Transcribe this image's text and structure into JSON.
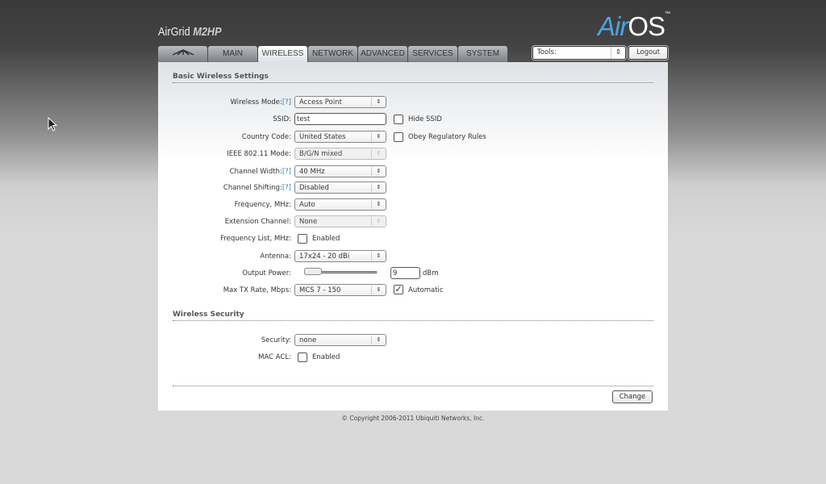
{
  "header": {
    "brand_prefix": "AirGrid",
    "brand_model": "M2HP",
    "logo_air": "Air",
    "logo_os": "OS",
    "logo_tm": "™"
  },
  "tabs": [
    {
      "label": ""
    },
    {
      "label": "MAIN"
    },
    {
      "label": "WIRELESS"
    },
    {
      "label": "NETWORK"
    },
    {
      "label": "ADVANCED"
    },
    {
      "label": "SERVICES"
    },
    {
      "label": "SYSTEM"
    }
  ],
  "tools": {
    "value": "Tools:",
    "arrow": "⇕"
  },
  "logout_label": "Logout",
  "basic": {
    "title": "Basic Wireless Settings",
    "wireless_mode": {
      "label": "Wireless Mode:",
      "help": "[?]",
      "value": "Access Point"
    },
    "ssid": {
      "label": "SSID:",
      "value": "test",
      "hide_label": "Hide SSID"
    },
    "country": {
      "label": "Country Code:",
      "value": "United States",
      "obey_label": "Obey Regulatory Rules"
    },
    "ieee": {
      "label": "IEEE 802.11 Mode:",
      "value": "B/G/N mixed"
    },
    "channel_width": {
      "label": "Channel Width:",
      "help": "[?]",
      "value": "40 MHz"
    },
    "channel_shifting": {
      "label": "Channel Shifting:",
      "help": "[?]",
      "value": "Disabled"
    },
    "frequency": {
      "label": "Frequency, MHz:",
      "value": "Auto"
    },
    "extension": {
      "label": "Extension Channel:",
      "value": "None"
    },
    "freq_list": {
      "label": "Frequency List, MHz:",
      "enabled_label": "Enabled",
      "checked": false
    },
    "antenna": {
      "label": "Antenna:",
      "value": "17x24 - 20 dBi"
    },
    "output_power": {
      "label": "Output Power:",
      "value": "9",
      "unit": "dBm",
      "slider_fraction": 0
    },
    "max_tx": {
      "label": "Max TX Rate, Mbps:",
      "value": "MCS 7 - 150",
      "auto_label": "Automatic",
      "auto_checked": true
    }
  },
  "security": {
    "title": "Wireless Security",
    "security": {
      "label": "Security:",
      "value": "none"
    },
    "mac_acl": {
      "label": "MAC ACL:",
      "enabled_label": "Enabled",
      "checked": false
    }
  },
  "change_label": "Change",
  "copyright": "© Copyright 2006-2011 Ubiquiti Networks, Inc."
}
